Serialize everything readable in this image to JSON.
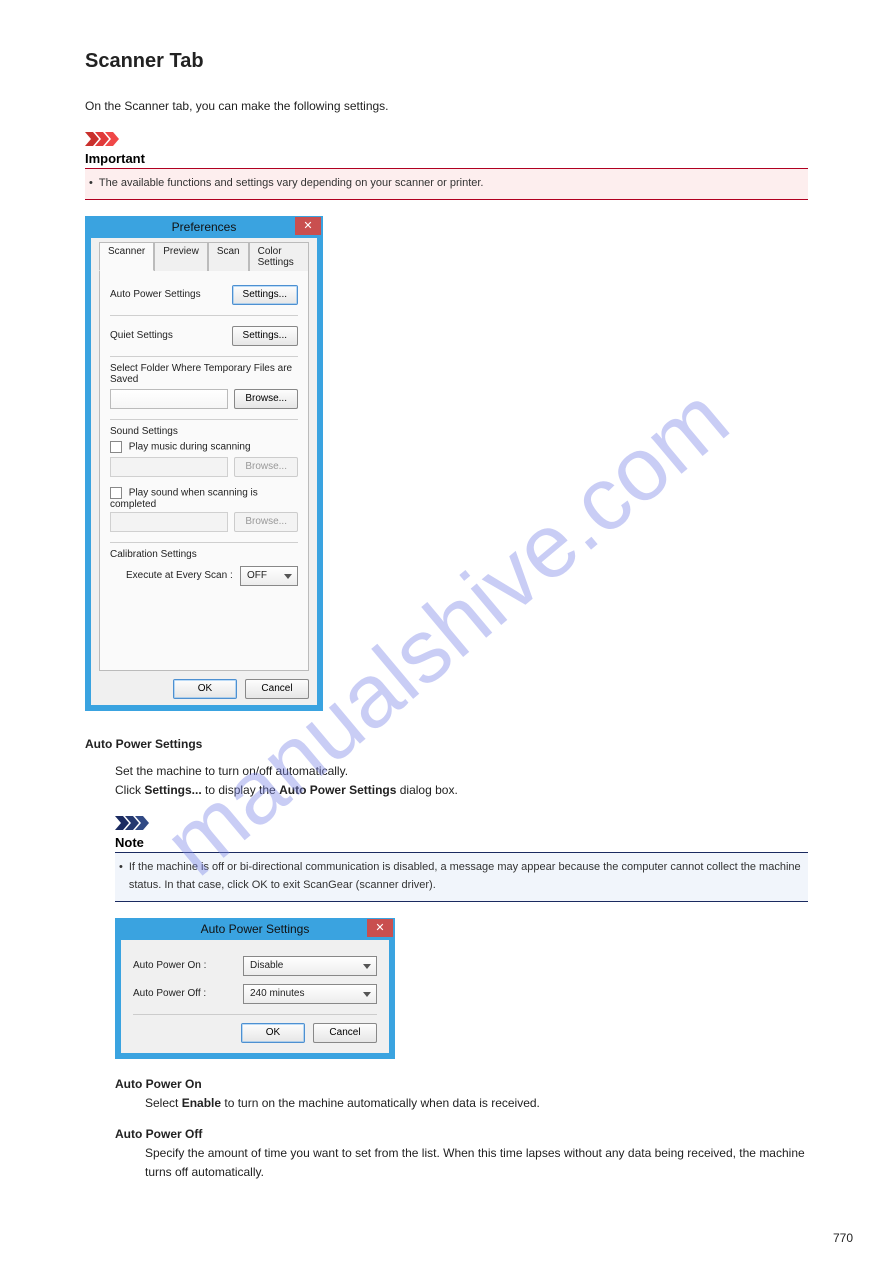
{
  "watermark": "manualshive.com",
  "title": "Scanner Tab",
  "intro": "On the Scanner tab, you can make the following settings.",
  "important_header": "Important",
  "important_text": "The available functions and settings vary depending on your scanner or printer.",
  "prefs_dialog": {
    "title": "Preferences",
    "tabs": [
      "Scanner",
      "Preview",
      "Scan",
      "Color Settings"
    ],
    "auto_power_label": "Auto Power Settings",
    "settings_btn": "Settings...",
    "quiet_label": "Quiet Settings",
    "folder_label": "Select Folder Where Temporary Files are Saved",
    "browse_btn": "Browse...",
    "sound_label": "Sound Settings",
    "play_music": "Play music during scanning",
    "play_sound_complete": "Play sound when scanning is completed",
    "calibration_label": "Calibration Settings",
    "execute_label": "Execute at Every Scan :",
    "execute_value": "OFF",
    "ok": "OK",
    "cancel": "Cancel"
  },
  "auto_power_heading": "Auto Power Settings",
  "auto_power_desc_1": "Set the machine to turn on/off automatically.",
  "auto_power_desc_2_prefix": "Click ",
  "auto_power_desc_2_bold": "Settings...",
  "auto_power_desc_2_suffix": " to display the ",
  "auto_power_desc_2_bold2": "Auto Power Settings",
  "auto_power_desc_2_end": " dialog box.",
  "note_header": "Note",
  "note_bullets": [
    "If the machine is off or bi-directional communication is disabled, a message may appear because the computer cannot collect the machine status. In that case, click OK to exit ScanGear (scanner driver)."
  ],
  "aps_dialog": {
    "title": "Auto Power Settings",
    "on_label": "Auto Power On :",
    "on_value": "Disable",
    "off_label": "Auto Power Off :",
    "off_value": "240 minutes",
    "ok": "OK",
    "cancel": "Cancel"
  },
  "power_on_title": "Auto Power On",
  "power_on_text_1": "Select ",
  "power_on_bold": "Enable",
  "power_on_text_2": " to turn on the machine automatically when data is received.",
  "power_off_title": "Auto Power Off",
  "power_off_text": "Specify the amount of time you want to set from the list. When this time lapses without any data being received, the machine turns off automatically.",
  "page_number": "770"
}
